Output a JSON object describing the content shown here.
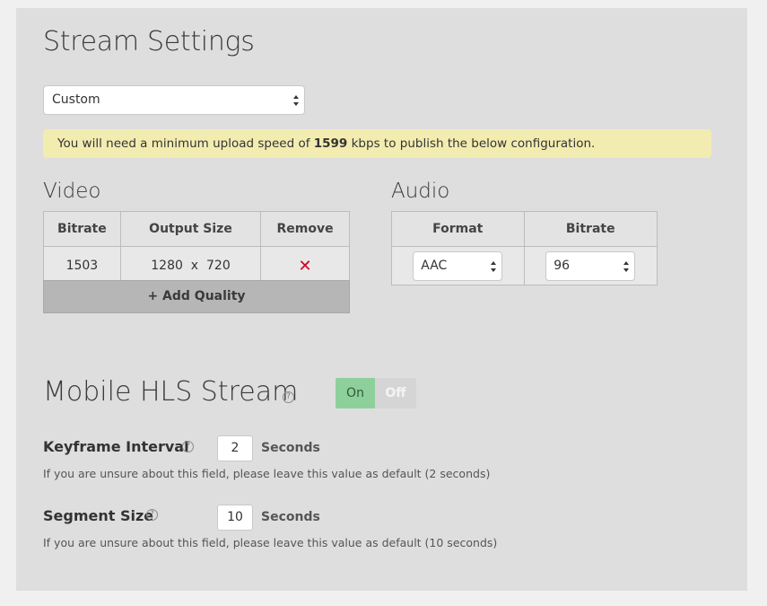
{
  "page": {
    "title": "Stream Settings"
  },
  "preset": {
    "value": "Custom"
  },
  "notice": {
    "prefix": "You will need a minimum upload speed of ",
    "speed": "1599",
    "suffix": " kbps to publish the below configuration."
  },
  "video": {
    "title": "Video",
    "headers": [
      "Bitrate",
      "Output Size",
      "Remove"
    ],
    "rows": [
      {
        "bitrate": "1503",
        "width": "1280",
        "separator": "x",
        "height": "720",
        "remove": "✕"
      }
    ],
    "add_label": "+ Add Quality"
  },
  "audio": {
    "title": "Audio",
    "headers": [
      "Format",
      "Bitrate"
    ],
    "format": "AAC",
    "bitrate": "96"
  },
  "hls": {
    "title": "Mobile HLS Stream",
    "help_glyph": "?",
    "toggle_on": "On",
    "toggle_off": "Off"
  },
  "keyframe": {
    "label": "Keyframe Interval",
    "value": "2",
    "unit": "Seconds",
    "hint": "If you are unsure about this field, please leave this value as default (2 seconds)"
  },
  "segment": {
    "label": "Segment Size",
    "value": "10",
    "unit": "Seconds",
    "hint": "If you are unsure about this field, please leave this value as default (10 seconds)"
  },
  "colors": {
    "panel": "#dedede",
    "notice_bg": "#f2ecb1",
    "toggle_on": "#8ed09c",
    "remove": "#d0021b"
  }
}
